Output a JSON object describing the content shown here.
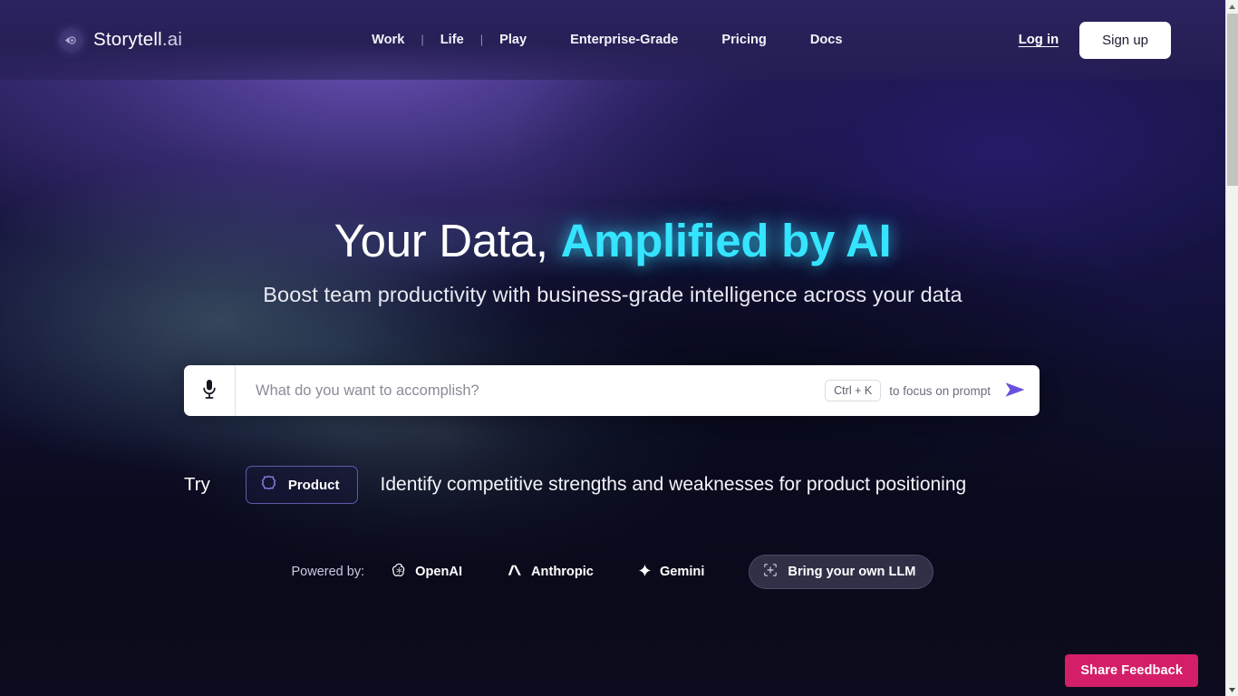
{
  "brand": {
    "name": "Storytell",
    "tld": ".ai",
    "mark_icon": "storytell-orb-icon"
  },
  "nav": {
    "items": [
      {
        "label": "Work"
      },
      {
        "label": "|"
      },
      {
        "label": "Life"
      },
      {
        "label": "|"
      },
      {
        "label": "Play"
      },
      {
        "label": "Enterprise-Grade"
      },
      {
        "label": "Pricing"
      },
      {
        "label": "Docs"
      }
    ]
  },
  "auth": {
    "login_label": "Log in",
    "signup_label": "Sign up"
  },
  "hero": {
    "headline_plain": "Your Data, ",
    "headline_accent": "Amplified by AI",
    "subheadline": "Boost team productivity with business-grade intelligence across your data",
    "accent_color": "#35e4ff"
  },
  "prompt": {
    "placeholder": "What do you want to accomplish?",
    "value": "",
    "mic_icon": "microphone-icon",
    "shortcut_key": "Ctrl + K",
    "shortcut_hint": "to focus on prompt",
    "send_icon": "send-arrow-icon",
    "send_color": "#6d4fe0"
  },
  "try": {
    "label": "Try",
    "chip_label": "Product",
    "chip_icon": "product-gear-icon",
    "chip_border_color": "#5f5aa8",
    "suggestion": "Identify competitive strengths and weaknesses for product positioning"
  },
  "powered": {
    "label": "Powered by:",
    "providers": [
      {
        "name": "OpenAI",
        "icon": "openai-logo-icon"
      },
      {
        "name": "Anthropic",
        "icon": "anthropic-logo-icon"
      },
      {
        "name": "Gemini",
        "icon": "gemini-sparkle-icon"
      }
    ],
    "byo_label": "Bring your own LLM",
    "byo_icon": "add-frame-icon"
  },
  "feedback": {
    "label": "Share Feedback",
    "color": "#d41e68"
  },
  "scrollbar": {
    "up_icon": "scroll-up-arrow-icon",
    "down_icon": "scroll-down-arrow-icon"
  }
}
